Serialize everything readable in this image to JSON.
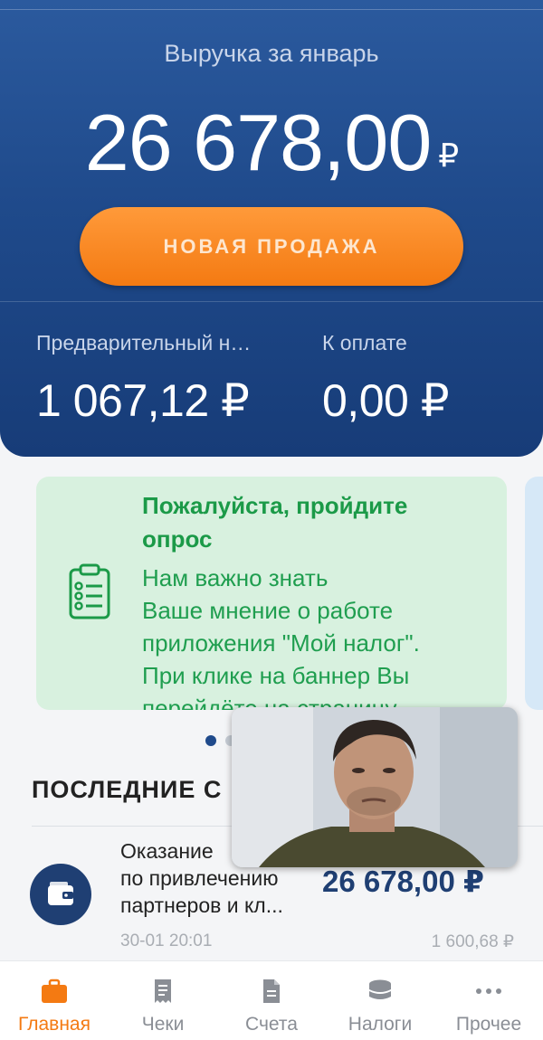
{
  "header": {
    "revenue_title": "Выручка за январь",
    "revenue_amount": "26 678,00",
    "currency_small": "₽",
    "new_sale_label": "НОВАЯ ПРОДАЖА",
    "prelim_label": "Предварительный н…",
    "prelim_value": "1 067,12 ₽",
    "due_label": "К оплате",
    "due_value": "0,00 ₽"
  },
  "banner": {
    "icon": "clipboard-list-icon",
    "title_line1": "Пожалуйста, пройдите",
    "title_line2": "опрос",
    "text_line1": "Нам важно знать",
    "text_line2": "Ваше мнение о работе",
    "text_line3": "приложения \"Мой налог\".",
    "text_line4": "При клике на баннер Вы",
    "text_line5": "перейдёте на страницу",
    "active_page": 1,
    "pages": 2
  },
  "recent": {
    "section_title": "ПОСЛЕДНИЕ С",
    "operations": [
      {
        "icon": "wallet-icon",
        "desc_line1": "Оказание",
        "desc_line2": "по привлечению",
        "desc_line3": "партнеров и кл...",
        "amount": "26 678,00 ₽",
        "date": "30-01 20:01",
        "tax": "1 600,68 ₽"
      }
    ]
  },
  "nav": {
    "items": [
      {
        "label": "Главная",
        "icon": "briefcase-icon",
        "active": true
      },
      {
        "label": "Чеки",
        "icon": "receipt-icon",
        "active": false
      },
      {
        "label": "Счета",
        "icon": "document-icon",
        "active": false
      },
      {
        "label": "Налоги",
        "icon": "coins-icon",
        "active": false
      },
      {
        "label": "Прочее",
        "icon": "more-icon",
        "active": false
      }
    ]
  },
  "colors": {
    "header_blue": "#1f4a8b",
    "accent_orange": "#f47a12",
    "banner_green_bg": "#d8f1df",
    "banner_green_text": "#1b9a48",
    "amount_navy": "#1f3f73"
  }
}
